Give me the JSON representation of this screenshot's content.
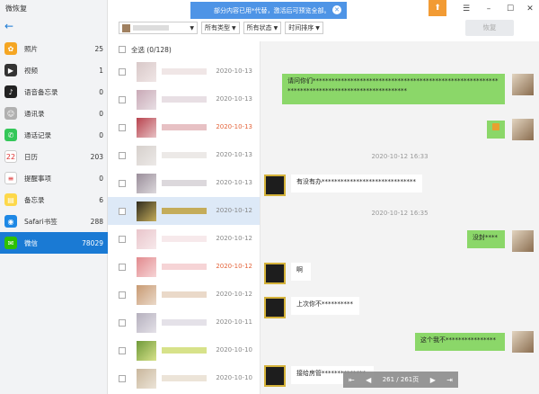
{
  "app": {
    "title": "微恢复"
  },
  "sidebar": {
    "items": [
      {
        "label": "照片",
        "count": "25",
        "icon": "photos-icon",
        "color": "#f5a623",
        "glyph": "✿"
      },
      {
        "label": "视频",
        "count": "1",
        "icon": "video-icon",
        "color": "#333333",
        "glyph": "▶"
      },
      {
        "label": "语音备忘录",
        "count": "0",
        "icon": "voice-memo-icon",
        "color": "#222222",
        "glyph": "♪"
      },
      {
        "label": "通讯录",
        "count": "0",
        "icon": "contacts-icon",
        "color": "#b0b0b0",
        "glyph": "☺"
      },
      {
        "label": "通话记录",
        "count": "0",
        "icon": "phone-icon",
        "color": "#34c759",
        "glyph": "✆"
      },
      {
        "label": "日历",
        "count": "203",
        "icon": "calendar-icon",
        "color": "#ffffff",
        "glyph": "22"
      },
      {
        "label": "提醒事项",
        "count": "0",
        "icon": "reminders-icon",
        "color": "#ffffff",
        "glyph": "≡"
      },
      {
        "label": "备忘录",
        "count": "6",
        "icon": "notes-icon",
        "color": "#fdd84a",
        "glyph": "▤"
      },
      {
        "label": "Safari书签",
        "count": "288",
        "icon": "safari-icon",
        "color": "#1e88e5",
        "glyph": "◉"
      },
      {
        "label": "微信",
        "count": "78029",
        "icon": "wechat-icon",
        "color": "#2dc100",
        "glyph": "✉"
      }
    ]
  },
  "topbar": {
    "notice": "部分内容已用*代替，激活后可预览全部。",
    "filters": {
      "type": "所有类型",
      "status": "所有状态",
      "sort": "时间排序"
    },
    "restore_label": "恢复"
  },
  "list": {
    "select_all": "全选 (0/128)",
    "rows": [
      {
        "date": "2020-10-13",
        "red": false,
        "colors": [
          "#d8c8c8",
          "#f0e6e6"
        ]
      },
      {
        "date": "2020-10-13",
        "red": false,
        "colors": [
          "#c9a9b6",
          "#e8dfe4"
        ]
      },
      {
        "date": "2020-10-13",
        "red": true,
        "colors": [
          "#b8434e",
          "#e7c1c4"
        ]
      },
      {
        "date": "2020-10-13",
        "red": false,
        "colors": [
          "#d6d0cc",
          "#ece9e7"
        ]
      },
      {
        "date": "2020-10-13",
        "red": false,
        "colors": [
          "#9a8e9a",
          "#dcd8dc"
        ]
      },
      {
        "date": "2020-10-12",
        "red": false,
        "colors": [
          "#2f2b1e",
          "#c4ac5a"
        ]
      },
      {
        "date": "2020-10-12",
        "red": false,
        "colors": [
          "#e9c5cb",
          "#f7e9eb"
        ]
      },
      {
        "date": "2020-10-12",
        "red": true,
        "colors": [
          "#e28a8e",
          "#f6d4d6"
        ]
      },
      {
        "date": "2020-10-12",
        "red": false,
        "colors": [
          "#c89a72",
          "#ead9c9"
        ]
      },
      {
        "date": "2020-10-11",
        "red": false,
        "colors": [
          "#b5b0bd",
          "#e4e1e8"
        ]
      },
      {
        "date": "2020-10-10",
        "red": false,
        "colors": [
          "#6f9a3a",
          "#d7e28a"
        ]
      },
      {
        "date": "2020-10-10",
        "red": false,
        "colors": [
          "#c9b79c",
          "#ece4d8"
        ]
      }
    ]
  },
  "chat": {
    "messages": [
      {
        "dir": "out",
        "text": "请问你们*************************************************************************************************"
      },
      {
        "dir": "out",
        "text": "emoji"
      },
      {
        "dir": "stamp",
        "text": "2020-10-12 16:33"
      },
      {
        "dir": "in",
        "text": "有没有办******************************"
      },
      {
        "dir": "stamp",
        "text": "2020-10-12 16:35"
      },
      {
        "dir": "out",
        "text": "没封****"
      },
      {
        "dir": "in",
        "text": "啊"
      },
      {
        "dir": "in",
        "text": "上次你不**********"
      },
      {
        "dir": "out",
        "text": "这个我不****************"
      },
      {
        "dir": "in",
        "text": "接给房管**************"
      }
    ]
  },
  "pager": {
    "current": "261",
    "total": "261页"
  }
}
